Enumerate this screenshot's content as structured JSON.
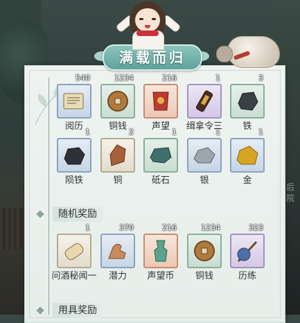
{
  "banner": {
    "title": "满载而归"
  },
  "background_text": "后 院",
  "sections": [
    {
      "label": "随机奖励"
    },
    {
      "label": "用具奖励"
    }
  ],
  "rows": [
    {
      "items": [
        {
          "name": "阅历",
          "count": "540",
          "quality": "blue",
          "icon": "scroll-icon"
        },
        {
          "name": "铜钱",
          "count": "1234",
          "quality": "green",
          "icon": "copper-coin-icon"
        },
        {
          "name": "声望",
          "count": "216",
          "quality": "orange",
          "icon": "red-banner-icon"
        },
        {
          "name": "缉拿令三",
          "count": "1",
          "quality": "purple",
          "icon": "arrest-token-icon"
        },
        {
          "name": "铁",
          "count": "3",
          "quality": "green",
          "icon": "iron-ore-icon"
        }
      ]
    },
    {
      "items": [
        {
          "name": "陨铁",
          "count": "1",
          "quality": "blue",
          "icon": "meteor-iron-icon"
        },
        {
          "name": "铜",
          "count": "2",
          "quality": "white",
          "icon": "copper-ore-icon"
        },
        {
          "name": "砥石",
          "count": "1",
          "quality": "green",
          "icon": "whetstone-icon"
        },
        {
          "name": "银",
          "count": "1",
          "quality": "blue",
          "icon": "silver-ore-icon"
        },
        {
          "name": "金",
          "count": "1",
          "quality": "blue",
          "icon": "gold-ore-icon"
        }
      ]
    },
    {
      "items": [
        {
          "name": "问酒秘闻一",
          "count": "1",
          "quality": "white",
          "icon": "scroll-roll-icon"
        },
        {
          "name": "潜力",
          "count": "370",
          "quality": "blue",
          "icon": "muscle-arm-icon"
        },
        {
          "name": "声望币",
          "count": "216",
          "quality": "orange",
          "icon": "jade-token-icon"
        },
        {
          "name": "铜钱",
          "count": "1234",
          "quality": "green",
          "icon": "copper-coin-icon"
        },
        {
          "name": "历练",
          "count": "323",
          "quality": "purple",
          "icon": "travel-bundle-icon"
        }
      ]
    }
  ]
}
